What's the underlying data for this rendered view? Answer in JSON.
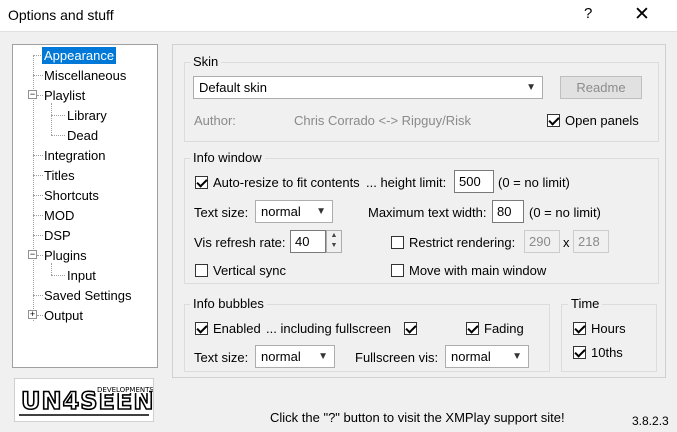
{
  "window": {
    "title": "Options and stuff",
    "help_glyph": "?",
    "close_glyph": "✕"
  },
  "tree": {
    "items": [
      {
        "label": "Appearance",
        "selected": true
      },
      {
        "label": "Miscellaneous"
      },
      {
        "label": "Playlist",
        "expanded": true
      },
      {
        "label": "Library"
      },
      {
        "label": "Dead"
      },
      {
        "label": "Integration"
      },
      {
        "label": "Titles"
      },
      {
        "label": "Shortcuts"
      },
      {
        "label": "MOD"
      },
      {
        "label": "DSP"
      },
      {
        "label": "Plugins",
        "expanded": true
      },
      {
        "label": "Input"
      },
      {
        "label": "Saved Settings"
      },
      {
        "label": "Output",
        "expanded": false
      }
    ],
    "minus": "−",
    "plus": "+"
  },
  "logo": {
    "text_main": "UN4SEEN",
    "text_sub": "DEVELOPMENTS"
  },
  "skin": {
    "group_label": "Skin",
    "selected": "Default skin",
    "readme_label": "Readme",
    "author_label": "Author:",
    "author_value": "Chris Corrado <-> Ripguy/Risk",
    "open_panels_label": "Open panels",
    "open_panels_checked": true
  },
  "info_window": {
    "group_label": "Info window",
    "auto_resize_label": "Auto-resize to fit contents",
    "auto_resize_checked": true,
    "height_limit_label": "... height limit:",
    "height_limit_value": "500",
    "height_limit_hint": "(0 = no limit)",
    "text_size_label": "Text size:",
    "text_size_value": "normal",
    "max_width_label": "Maximum text width:",
    "max_width_value": "80",
    "max_width_hint": "(0 = no limit)",
    "vis_refresh_label": "Vis refresh rate:",
    "vis_refresh_value": "40",
    "restrict_label": "Restrict rendering:",
    "restrict_checked": false,
    "restrict_w": "290",
    "restrict_x": "x",
    "restrict_h": "218",
    "vsync_label": "Vertical sync",
    "vsync_checked": false,
    "move_label": "Move with main window",
    "move_checked": false
  },
  "info_bubbles": {
    "group_label": "Info bubbles",
    "enabled_label": "Enabled",
    "enabled_checked": true,
    "fullscreen_label": "... including fullscreen",
    "fullscreen_checked": true,
    "fading_label": "Fading",
    "fading_checked": true,
    "text_size_label": "Text size:",
    "text_size_value": "normal",
    "fullscreen_vis_label": "Fullscreen vis:",
    "fullscreen_vis_value": "normal"
  },
  "time": {
    "group_label": "Time",
    "hours_label": "Hours",
    "hours_checked": true,
    "tenths_label": "10ths",
    "tenths_checked": true
  },
  "status_text": "Click the \"?\" button to visit the XMPlay support site!",
  "version": "3.8.2.3"
}
